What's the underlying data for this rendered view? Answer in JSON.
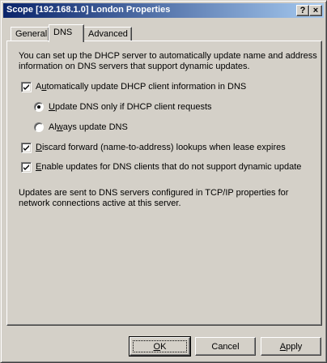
{
  "window": {
    "title": "Scope [192.168.1.0] London Properties",
    "help_glyph": "?",
    "close_glyph": "×"
  },
  "tabs": [
    {
      "label": "General",
      "active": false
    },
    {
      "label": "DNS",
      "active": true
    },
    {
      "label": "Advanced",
      "active": false
    }
  ],
  "panel": {
    "intro": "You can set up the DHCP server to automatically update name and address information on DNS servers that support dynamic updates.",
    "options": {
      "auto_update": {
        "pre": "A",
        "u": "u",
        "post": "tomatically update DHCP client information in DNS",
        "checked": true
      },
      "update_if_requested": {
        "pre": "",
        "u": "U",
        "post": "pdate DNS only if DHCP client requests",
        "selected": true
      },
      "always_update": {
        "pre": "Al",
        "u": "w",
        "post": "ays update DNS",
        "selected": false
      },
      "discard_forward": {
        "pre": "",
        "u": "D",
        "post": "iscard forward (name-to-address) lookups when lease expires",
        "checked": true
      },
      "enable_updates": {
        "pre": "",
        "u": "E",
        "post": "nable updates for DNS clients that do not support dynamic update",
        "checked": true
      }
    },
    "footer_note": "Updates are sent to DNS servers configured in TCP/IP properties for network connections active at this server."
  },
  "buttons": {
    "ok": {
      "pre": "",
      "u": "O",
      "post": "K"
    },
    "cancel": {
      "label": "Cancel"
    },
    "apply": {
      "pre": "",
      "u": "A",
      "post": "pply"
    }
  }
}
